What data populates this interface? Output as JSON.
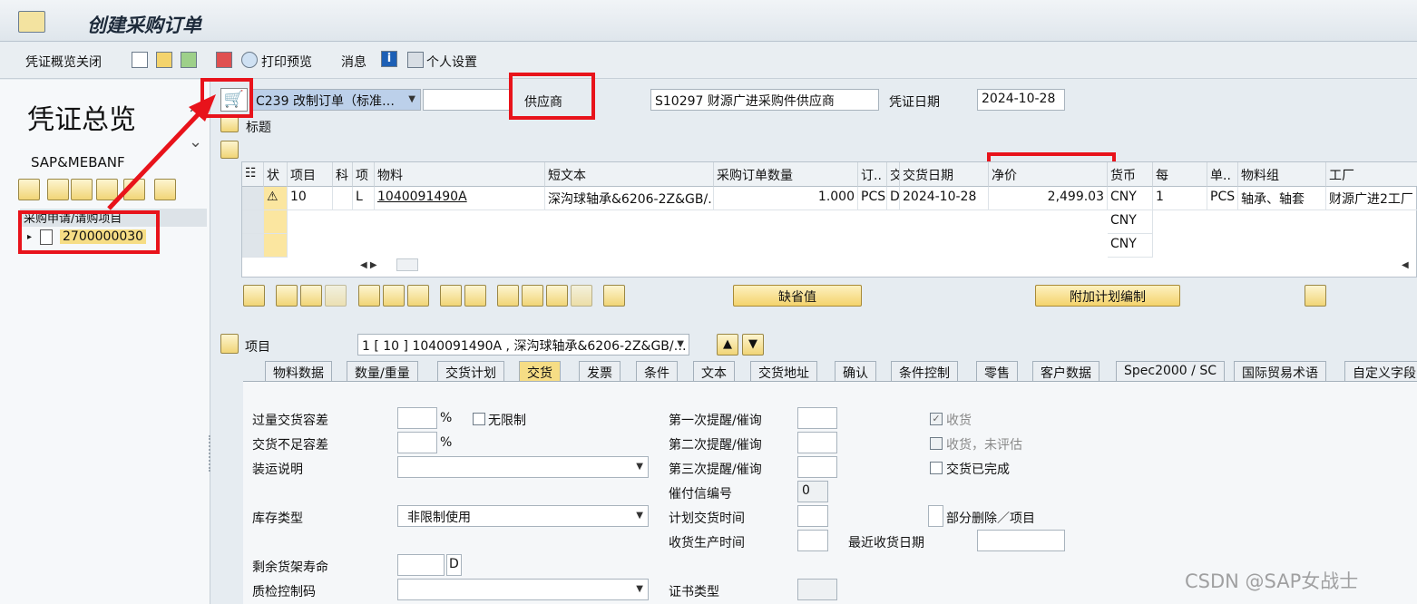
{
  "window": {
    "title": "创建采购订单"
  },
  "toolbar": {
    "close_overview": "凭证概览关闭",
    "print_preview": "打印预览",
    "messages": "消息",
    "personal_settings": "个人设置"
  },
  "sidebar": {
    "heading": "凭证总览",
    "variant": "SAP&MEBANF",
    "tree_header": "采购申请/请购项目",
    "tree_item": "2700000030"
  },
  "header": {
    "doc_type": "C239 改制订单（标准…",
    "vendor_label": "供应商",
    "vendor_value": "S10297 财源广进采购件供应商",
    "date_label": "凭证日期",
    "date_value": "2024-10-28",
    "title_label": "标题"
  },
  "grid": {
    "columns": [
      "状",
      "项目",
      "科",
      "项",
      "物料",
      "短文本",
      "采购订单数量",
      "订..",
      "交",
      "交货日期",
      "净价",
      "货币",
      "每",
      "单..",
      "物料组",
      "工厂"
    ],
    "row": {
      "item": "10",
      "acct": "L",
      "material": "1040091490A",
      "short_text": "深沟球轴承&6206-2Z&GB/…",
      "qty": "1.000",
      "unit": "PCS",
      "cat": "D",
      "date": "2024-10-28",
      "price": "2,499.03",
      "currency": "CNY",
      "per": "1",
      "order_unit": "PCS",
      "mat_group": "轴承、轴套",
      "plant": "财源广进2工厂"
    },
    "empty_currency": "CNY"
  },
  "buttons": {
    "default_values": "缺省值",
    "additional_planning": "附加计划编制"
  },
  "item_bar": {
    "label": "项目",
    "value": "1 [ 10 ] 1040091490A , 深沟球轴承&6206-2Z&GB/…"
  },
  "tabs": [
    "物料数据",
    "数量/重量",
    "交货计划",
    "交货",
    "发票",
    "条件",
    "文本",
    "交货地址",
    "确认",
    "条件控制",
    "零售",
    "客户数据",
    "Spec2000 / SC",
    "国际贸易术语",
    "自定义字段"
  ],
  "active_tab": "交货",
  "delivery": {
    "overdelivery": "过量交货容差",
    "pct": "%",
    "unlimited": "无限制",
    "underdelivery": "交货不足容差",
    "shipping": "装运说明",
    "stock_type": "库存类型",
    "stock_type_value": "非限制使用",
    "shelf_life": "剩余货架寿命",
    "shelf_unit": "D",
    "qi_code": "质检控制码",
    "reminder1": "第一次提醒/催询",
    "reminder2": "第二次提醒/催询",
    "reminder3": "第三次提醒/催询",
    "dunning": "催付信编号",
    "dunning_value": "0",
    "planned_delivery": "计划交货时间",
    "gr_processing": "收货生产时间",
    "cert_type": "证书类型",
    "gr": "收货",
    "gr_nonval": "收货，未评估",
    "delivery_complete": "交货已完成",
    "partial_delete": "部分删除／项目",
    "last_gr_date": "最近收货日期"
  },
  "watermark": "CSDN @SAP女战士",
  "colors": {
    "annotation_red": "#e8131b",
    "active_tab": "#f6dd85"
  }
}
